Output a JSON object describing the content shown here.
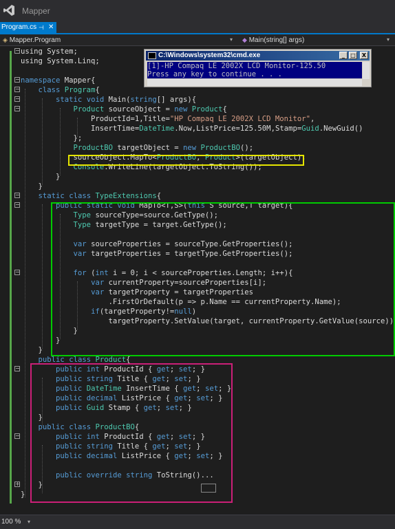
{
  "app": {
    "title": "Mapper"
  },
  "tabs": [
    {
      "label": "Program.cs",
      "pin": "⊣",
      "close": "✕"
    }
  ],
  "nav": {
    "left": "Mapper.Program",
    "right": "Main(string[] args)",
    "dropdown": "▾"
  },
  "cmd": {
    "title": "C:\\Windows\\system32\\cmd.exe",
    "buttons": [
      "_",
      "□",
      "X"
    ],
    "lines": [
      "[1]-HP Compaq LE 2002X LCD Monitor-125.50",
      "Press any key to continue . . ."
    ]
  },
  "code": [
    [
      [
        "using System;",
        "t"
      ]
    ],
    [
      [
        "using System.Linq;",
        "t"
      ]
    ],
    [
      [
        "",
        "t"
      ]
    ],
    [
      [
        "namespace",
        "k"
      ],
      [
        " Mapper{",
        "t"
      ]
    ],
    [
      [
        "    ",
        "t"
      ],
      [
        "class",
        "k"
      ],
      [
        " ",
        "t"
      ],
      [
        "Program",
        "y"
      ],
      [
        "{",
        "t"
      ]
    ],
    [
      [
        "        ",
        "t"
      ],
      [
        "static",
        "k"
      ],
      [
        " ",
        "t"
      ],
      [
        "void",
        "k"
      ],
      [
        " Main(",
        "t"
      ],
      [
        "string",
        "k"
      ],
      [
        "[] args){",
        "t"
      ]
    ],
    [
      [
        "            ",
        "t"
      ],
      [
        "Product",
        "y"
      ],
      [
        " sourceObject = ",
        "t"
      ],
      [
        "new",
        "k"
      ],
      [
        " ",
        "t"
      ],
      [
        "Product",
        "y"
      ],
      [
        "{",
        "t"
      ]
    ],
    [
      [
        "                ProductId=1,Title=",
        "t"
      ],
      [
        "\"HP Compaq LE 2002X LCD Monitor\"",
        "s"
      ],
      [
        ",",
        "t"
      ]
    ],
    [
      [
        "                InsertTime=",
        "t"
      ],
      [
        "DateTime",
        "y"
      ],
      [
        ".Now,ListPrice=125.50M,Stamp=",
        "t"
      ],
      [
        "Guid",
        "y"
      ],
      [
        ".NewGuid()",
        "t"
      ]
    ],
    [
      [
        "            };",
        "t"
      ]
    ],
    [
      [
        "            ",
        "t"
      ],
      [
        "ProductBO",
        "y"
      ],
      [
        " targetObject = ",
        "t"
      ],
      [
        "new",
        "k"
      ],
      [
        " ",
        "t"
      ],
      [
        "ProductBO",
        "y"
      ],
      [
        "();",
        "t"
      ]
    ],
    [
      [
        "            sourceObject.MapTo<",
        "t"
      ],
      [
        "ProductBO",
        "y"
      ],
      [
        ", ",
        "t"
      ],
      [
        "Product",
        "y"
      ],
      [
        ">(targetObject);",
        "t"
      ]
    ],
    [
      [
        "            ",
        "t"
      ],
      [
        "Console",
        "y"
      ],
      [
        ".WriteLine(targetObject.ToString());",
        "t"
      ]
    ],
    [
      [
        "        }",
        "t"
      ]
    ],
    [
      [
        "    }",
        "t"
      ]
    ],
    [
      [
        "    ",
        "t"
      ],
      [
        "static",
        "k"
      ],
      [
        " ",
        "t"
      ],
      [
        "class",
        "k"
      ],
      [
        " ",
        "t"
      ],
      [
        "TypeExtensions",
        "y"
      ],
      [
        "{",
        "t"
      ]
    ],
    [
      [
        "        ",
        "t"
      ],
      [
        "public",
        "k"
      ],
      [
        " ",
        "t"
      ],
      [
        "static",
        "k"
      ],
      [
        " ",
        "t"
      ],
      [
        "void",
        "k"
      ],
      [
        " MapTo<T,S>(",
        "t"
      ],
      [
        "this",
        "k"
      ],
      [
        " S source,T target){",
        "t"
      ]
    ],
    [
      [
        "            ",
        "t"
      ],
      [
        "Type",
        "y"
      ],
      [
        " sourceType=source.GetType();",
        "t"
      ]
    ],
    [
      [
        "            ",
        "t"
      ],
      [
        "Type",
        "y"
      ],
      [
        " targetType = target.GetType();",
        "t"
      ]
    ],
    [
      [
        "",
        "t"
      ]
    ],
    [
      [
        "            ",
        "t"
      ],
      [
        "var",
        "k"
      ],
      [
        " sourceProperties = sourceType.GetProperties();",
        "t"
      ]
    ],
    [
      [
        "            ",
        "t"
      ],
      [
        "var",
        "k"
      ],
      [
        " targetProperties = targetType.GetProperties();",
        "t"
      ]
    ],
    [
      [
        "",
        "t"
      ]
    ],
    [
      [
        "            ",
        "t"
      ],
      [
        "for",
        "k"
      ],
      [
        " (",
        "t"
      ],
      [
        "int",
        "k"
      ],
      [
        " i = 0; i < sourceProperties.Length; i++){",
        "t"
      ]
    ],
    [
      [
        "                ",
        "t"
      ],
      [
        "var",
        "k"
      ],
      [
        " currentProperty=sourceProperties[i];",
        "t"
      ]
    ],
    [
      [
        "                ",
        "t"
      ],
      [
        "var",
        "k"
      ],
      [
        " targetProperty = targetProperties",
        "t"
      ]
    ],
    [
      [
        "                    .FirstOrDefault(p => p.Name == currentProperty.Name);",
        "t"
      ]
    ],
    [
      [
        "                ",
        "t"
      ],
      [
        "if",
        "k"
      ],
      [
        "(targetProperty!=",
        "t"
      ],
      [
        "null",
        "k"
      ],
      [
        ")",
        "t"
      ]
    ],
    [
      [
        "                    targetProperty.SetValue(target, currentProperty.GetValue(source));",
        "t"
      ]
    ],
    [
      [
        "            }",
        "t"
      ]
    ],
    [
      [
        "        }",
        "t"
      ]
    ],
    [
      [
        "    }",
        "t"
      ]
    ],
    [
      [
        "    ",
        "t"
      ],
      [
        "public",
        "k"
      ],
      [
        " ",
        "t"
      ],
      [
        "class",
        "k"
      ],
      [
        " ",
        "t"
      ],
      [
        "Product",
        "y"
      ],
      [
        "{",
        "t"
      ]
    ],
    [
      [
        "        ",
        "t"
      ],
      [
        "public",
        "k"
      ],
      [
        " ",
        "t"
      ],
      [
        "int",
        "k"
      ],
      [
        " ProductId { ",
        "t"
      ],
      [
        "get",
        "k"
      ],
      [
        "; ",
        "t"
      ],
      [
        "set",
        "k"
      ],
      [
        "; }",
        "t"
      ]
    ],
    [
      [
        "        ",
        "t"
      ],
      [
        "public",
        "k"
      ],
      [
        " ",
        "t"
      ],
      [
        "string",
        "k"
      ],
      [
        " Title { ",
        "t"
      ],
      [
        "get",
        "k"
      ],
      [
        "; ",
        "t"
      ],
      [
        "set",
        "k"
      ],
      [
        "; }",
        "t"
      ]
    ],
    [
      [
        "        ",
        "t"
      ],
      [
        "public",
        "k"
      ],
      [
        " ",
        "t"
      ],
      [
        "DateTime",
        "y"
      ],
      [
        " InsertTime { ",
        "t"
      ],
      [
        "get",
        "k"
      ],
      [
        "; ",
        "t"
      ],
      [
        "set",
        "k"
      ],
      [
        "; }",
        "t"
      ]
    ],
    [
      [
        "        ",
        "t"
      ],
      [
        "public",
        "k"
      ],
      [
        " ",
        "t"
      ],
      [
        "decimal",
        "k"
      ],
      [
        " ListPrice { ",
        "t"
      ],
      [
        "get",
        "k"
      ],
      [
        "; ",
        "t"
      ],
      [
        "set",
        "k"
      ],
      [
        "; }",
        "t"
      ]
    ],
    [
      [
        "        ",
        "t"
      ],
      [
        "public",
        "k"
      ],
      [
        " ",
        "t"
      ],
      [
        "Guid",
        "y"
      ],
      [
        " Stamp { ",
        "t"
      ],
      [
        "get",
        "k"
      ],
      [
        "; ",
        "t"
      ],
      [
        "set",
        "k"
      ],
      [
        "; }",
        "t"
      ]
    ],
    [
      [
        "    }",
        "t"
      ]
    ],
    [
      [
        "    ",
        "t"
      ],
      [
        "public",
        "k"
      ],
      [
        " ",
        "t"
      ],
      [
        "class",
        "k"
      ],
      [
        " ",
        "t"
      ],
      [
        "ProductBO",
        "y"
      ],
      [
        "{",
        "t"
      ]
    ],
    [
      [
        "        ",
        "t"
      ],
      [
        "public",
        "k"
      ],
      [
        " ",
        "t"
      ],
      [
        "int",
        "k"
      ],
      [
        " ProductId { ",
        "t"
      ],
      [
        "get",
        "k"
      ],
      [
        "; ",
        "t"
      ],
      [
        "set",
        "k"
      ],
      [
        "; }",
        "t"
      ]
    ],
    [
      [
        "        ",
        "t"
      ],
      [
        "public",
        "k"
      ],
      [
        " ",
        "t"
      ],
      [
        "string",
        "k"
      ],
      [
        " Title { ",
        "t"
      ],
      [
        "get",
        "k"
      ],
      [
        "; ",
        "t"
      ],
      [
        "set",
        "k"
      ],
      [
        "; }",
        "t"
      ]
    ],
    [
      [
        "        ",
        "t"
      ],
      [
        "public",
        "k"
      ],
      [
        " ",
        "t"
      ],
      [
        "decimal",
        "k"
      ],
      [
        " ListPrice { ",
        "t"
      ],
      [
        "get",
        "k"
      ],
      [
        "; ",
        "t"
      ],
      [
        "set",
        "k"
      ],
      [
        "; }",
        "t"
      ]
    ],
    [
      [
        "",
        "t"
      ]
    ],
    [
      [
        "        ",
        "t"
      ],
      [
        "public",
        "k"
      ],
      [
        " ",
        "t"
      ],
      [
        "override",
        "k"
      ],
      [
        " ",
        "t"
      ],
      [
        "string",
        "k"
      ],
      [
        " ToString()",
        "t"
      ],
      [
        "...",
        "t"
      ]
    ],
    [
      [
        "    }",
        "t"
      ]
    ],
    [
      [
        "}",
        "t"
      ]
    ]
  ],
  "status": {
    "zoom": "100 %",
    "dropdown": "▾"
  }
}
